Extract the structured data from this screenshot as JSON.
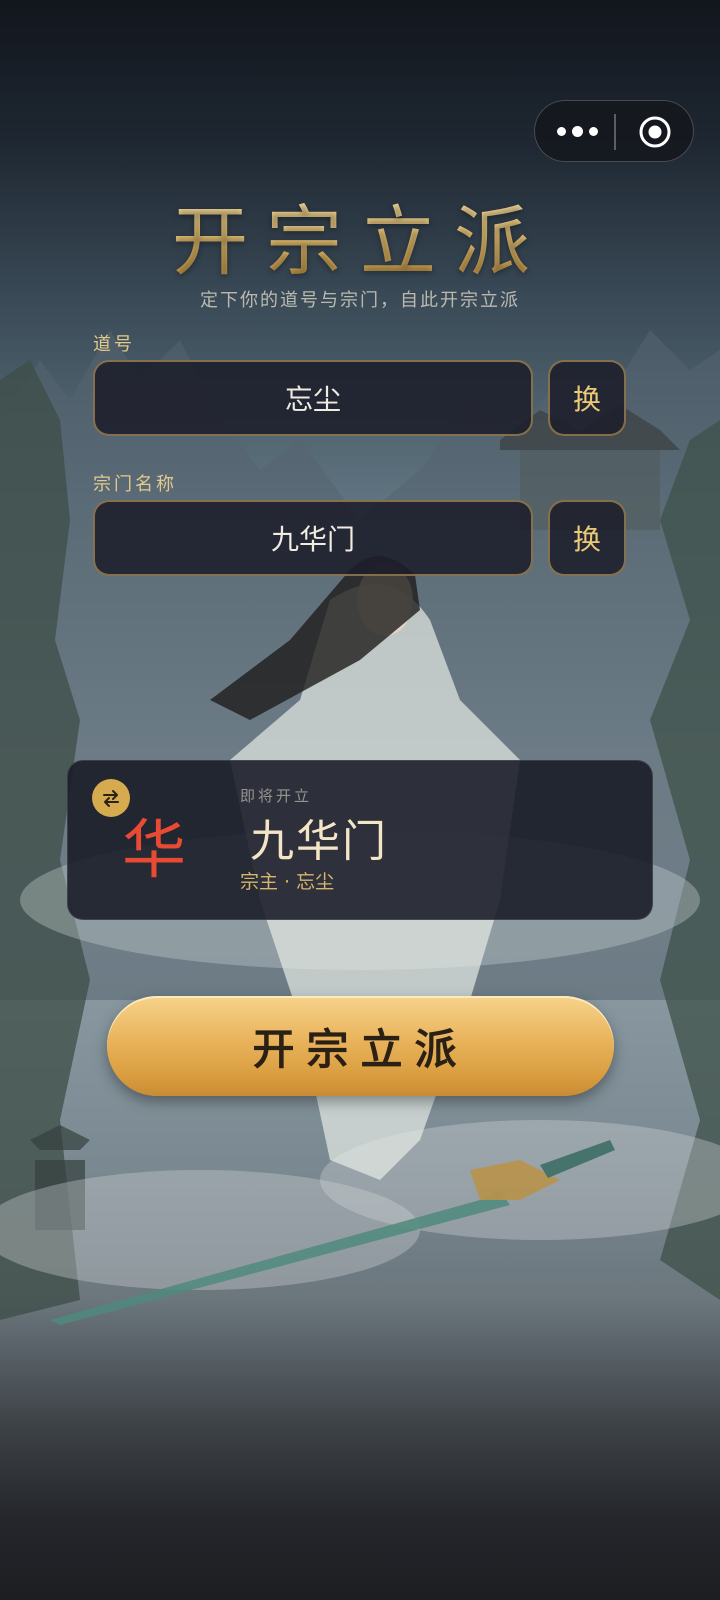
{
  "capsule": {
    "more_icon": "more-dots-icon",
    "close_icon": "target-close-icon"
  },
  "header": {
    "title": "开宗立派",
    "subtitle": "定下你的道号与宗门，自此开宗立派"
  },
  "form": {
    "daohao_label": "道号",
    "daohao_value": "忘尘",
    "sect_label": "宗门名称",
    "sect_value": "九华门",
    "swap_label": "换"
  },
  "preview": {
    "swap_icon": "swap-arrows-icon",
    "emblem_char": "华",
    "upcoming_label": "即将开立",
    "sect_name": "九华门",
    "master_line": "宗主 · 忘尘",
    "emblem_color": "#e84a34"
  },
  "cta": {
    "label": "开宗立派"
  },
  "colors": {
    "accent_gold": "#e5bf6f",
    "panel": "#1c1e2a"
  }
}
